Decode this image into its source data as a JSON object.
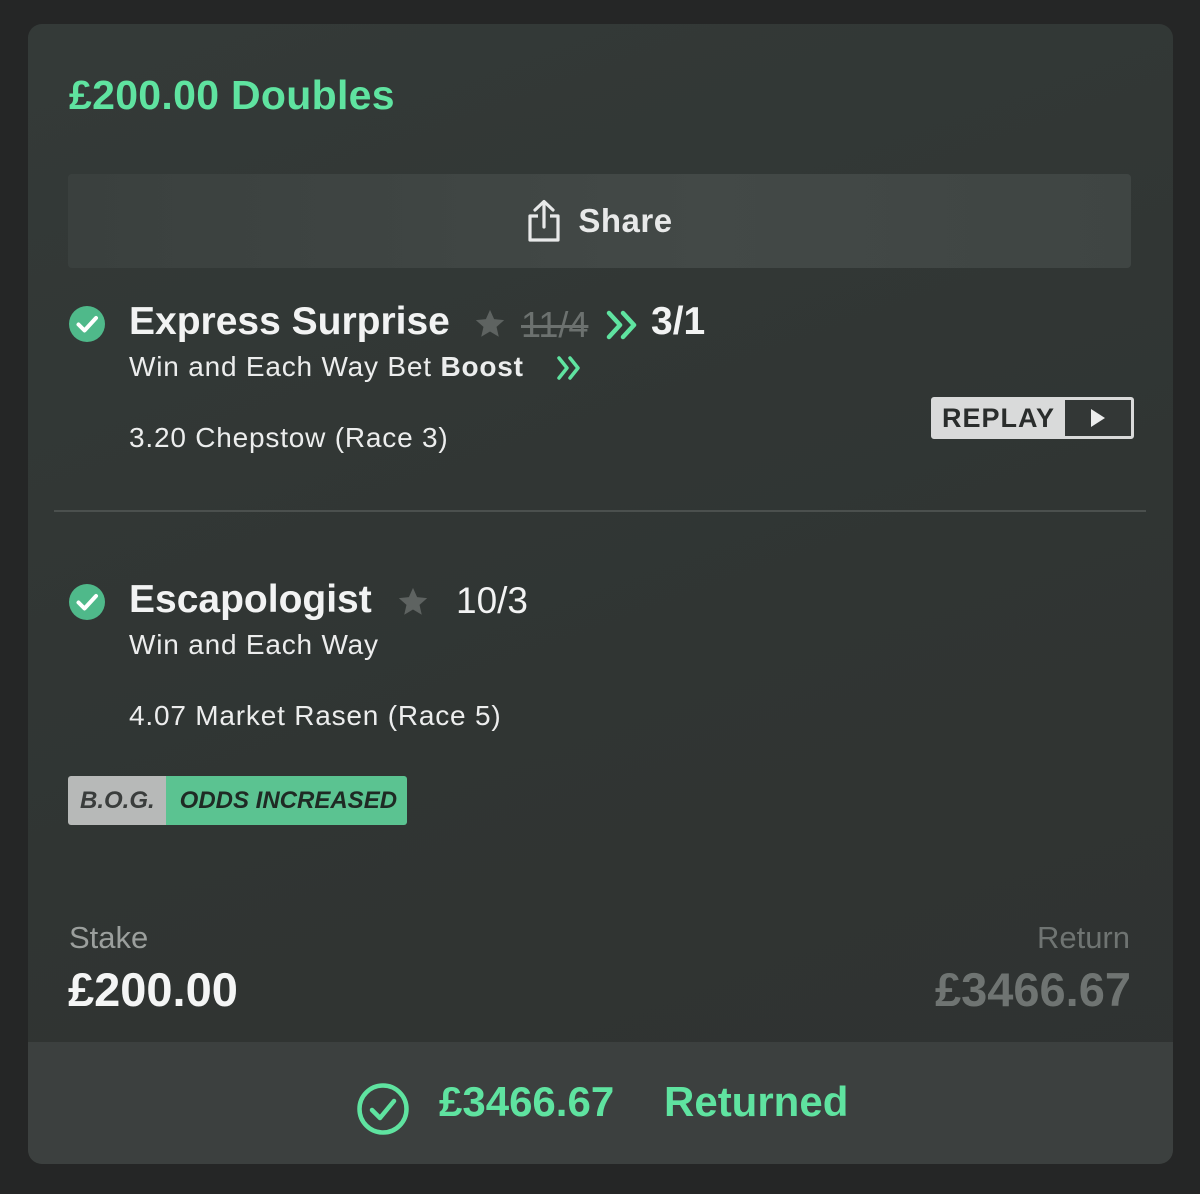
{
  "bet": {
    "title": "£200.00 Doubles",
    "share_label": "Share"
  },
  "selections": [
    {
      "name": "Express Surprise",
      "old_odds": "11/4",
      "new_odds": "3/1",
      "market_prefix": "Win and Each Way  Bet",
      "market_boost": "Boost",
      "event": "3.20 Chepstow (Race 3)",
      "replay_label": "REPLAY"
    },
    {
      "name": "Escapologist",
      "odds": "10/3",
      "market": "Win and Each Way",
      "event": "4.07 Market Rasen (Race 5)"
    }
  ],
  "badges": {
    "bog": "B.O.G.",
    "odds_increased": "ODDS INCREASED"
  },
  "summary": {
    "stake_label": "Stake",
    "stake_value": "£200.00",
    "return_label": "Return",
    "return_value": "£3466.67"
  },
  "footer": {
    "returned_amount": "£3466.67",
    "returned_label": "Returned"
  },
  "colors": {
    "accent_green": "#5fe3a0",
    "check_green": "#4fb98a",
    "badge_green": "#5bc391"
  },
  "icons": {
    "share": "share-icon",
    "check": "check-circle-icon",
    "star": "star-icon",
    "boost": "double-chevron-icon",
    "play": "play-icon",
    "returned": "check-circle-outline-icon"
  }
}
